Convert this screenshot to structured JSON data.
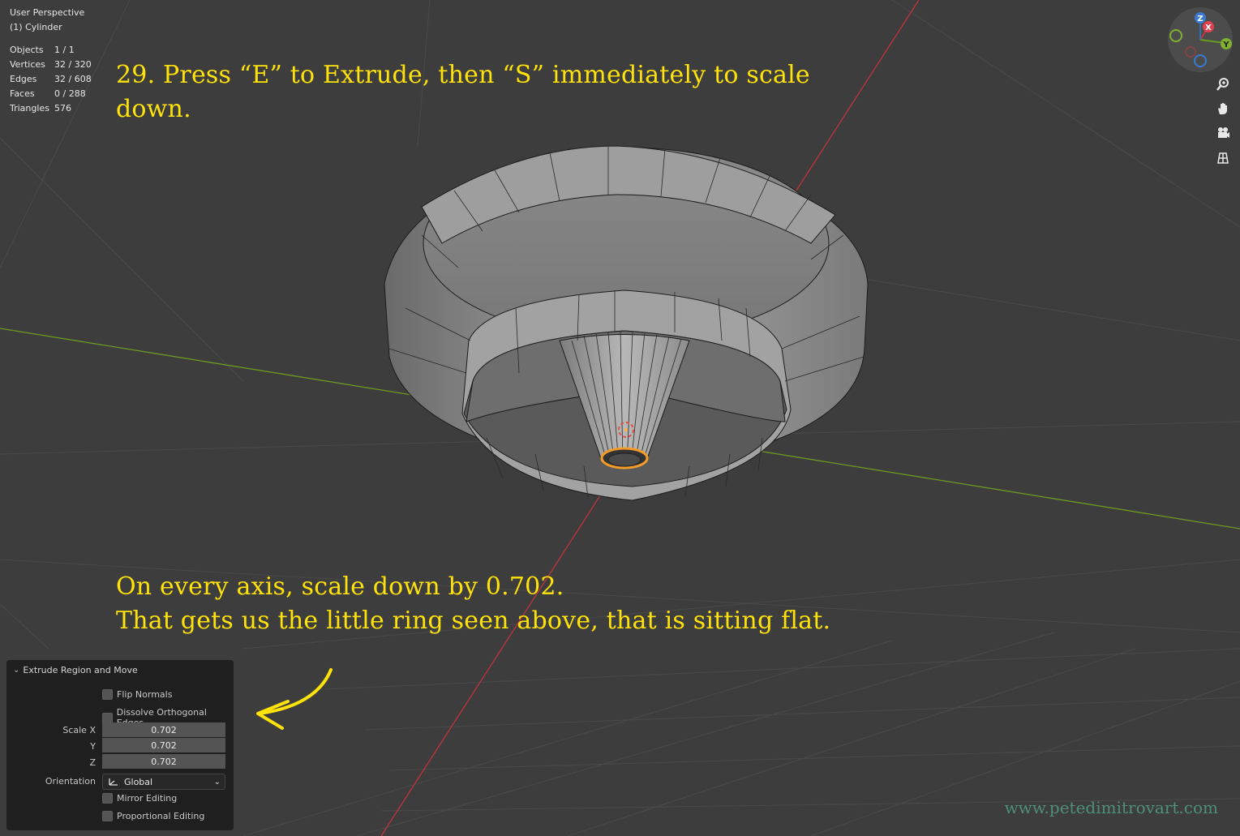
{
  "viewport": {
    "mode": "User Perspective",
    "object": "(1) Cylinder"
  },
  "stats": [
    {
      "label": "Objects",
      "value": "1 / 1"
    },
    {
      "label": "Vertices",
      "value": "32 / 320"
    },
    {
      "label": "Edges",
      "value": "32 / 608"
    },
    {
      "label": "Faces",
      "value": "0 / 288"
    },
    {
      "label": "Triangles",
      "value": "576"
    }
  ],
  "annotations": {
    "top": "29. Press “E” to Extrude, then “S” immediately to scale down.",
    "bottom_line1": "On every axis, scale down by 0.702.",
    "bottom_line2": "That gets us the little ring seen above, that is sitting flat."
  },
  "gizmo": {
    "x": "X",
    "y": "Y",
    "z": "Z"
  },
  "panel": {
    "title": "Extrude Region and Move",
    "flip_normals": "Flip Normals",
    "dissolve": "Dissolve Orthogonal Edges",
    "scale_label": "Scale X",
    "y_label": "Y",
    "z_label": "Z",
    "scale_x": "0.702",
    "scale_y": "0.702",
    "scale_z": "0.702",
    "orientation_label": "Orientation",
    "orientation_value": "Global",
    "mirror": "Mirror Editing",
    "proportional": "Proportional Editing"
  },
  "watermark": "www.petedimitrovart.com",
  "colors": {
    "background": "#3d3d3d",
    "annotation": "#ffe20a",
    "x_axis": "#c8333f",
    "y_axis": "#6a9a22",
    "z_axis": "#2f6fb5",
    "mesh": "#9a9a9a"
  }
}
